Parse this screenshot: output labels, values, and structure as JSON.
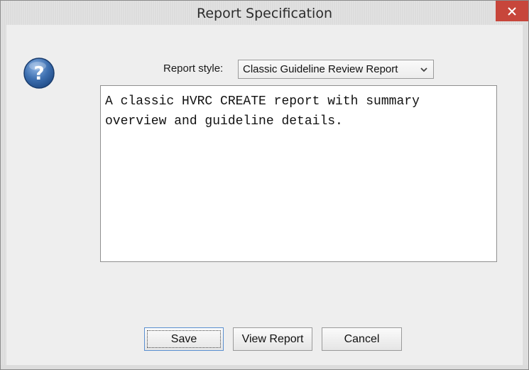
{
  "window": {
    "title": "Report Specification"
  },
  "titlebar": {
    "close_icon": "close-icon"
  },
  "icons": {
    "help": "question-help-icon",
    "dropdown": "chevron-down-icon"
  },
  "form": {
    "report_style_label": "Report style:",
    "report_style_value": "Classic Guideline Review Report",
    "description": "A classic HVRC CREATE report with summary overview and guideline details."
  },
  "buttons": {
    "save": "Save",
    "view_report": "View Report",
    "cancel": "Cancel"
  },
  "colors": {
    "close_button": "#c7463b",
    "help_icon": "#2d5f9c",
    "focus_border": "#5a8fd0"
  }
}
